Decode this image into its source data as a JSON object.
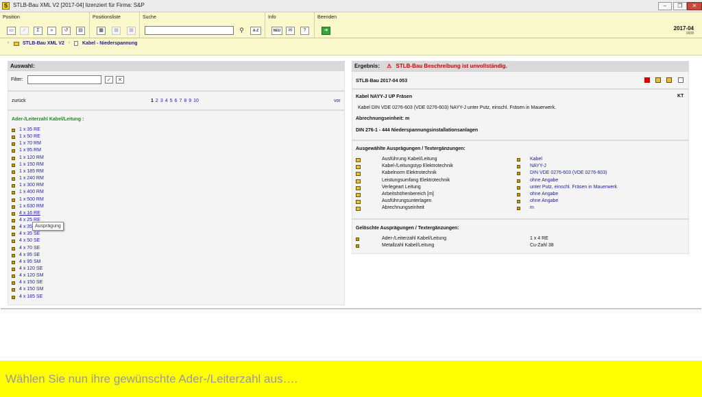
{
  "window": {
    "title": "STLB-Bau XML V2 [2017-04] lizenziert für Firma: S&P",
    "app_icon": "S"
  },
  "toolbar": {
    "groups": [
      "Position",
      "Positionsliste",
      "Suche",
      "Info",
      "Beenden"
    ],
    "search_btn_az": "A-Z",
    "info_new": "NEU",
    "version": "2017-04",
    "version_sub": "0008"
  },
  "breadcrumb": {
    "root": "STLB-Bau XML V2",
    "current": "Kabel - Niederspannung"
  },
  "left": {
    "header": "Auswahl:",
    "filter_label": "Filter:",
    "filter_value": "",
    "back": "zurück",
    "forward": "vor",
    "pages": [
      "1",
      "2",
      "3",
      "4",
      "5",
      "6",
      "7",
      "8",
      "9",
      "10"
    ],
    "current_page": "1",
    "list_title": "Ader-/Leiterzahl Kabel/Leitung :",
    "items": [
      "1 x 35 RE",
      "1 x 50 RE",
      "1 x 70 RM",
      "1 x 95 RM",
      "1 x 120 RM",
      "1 x 150 RM",
      "1 x 185 RM",
      "1 x 240 RM",
      "1 x 300 RM",
      "1 x 400 RM",
      "1 x 500 RM",
      "1 x 630 RM",
      "4 x 16 RE",
      "4 x 25 RE",
      "4 x 35 SE",
      "4 x 35 SE",
      "4 x 50 SE",
      "4 x 70 SE",
      "4 x 95 SE",
      "4 x 95 SM",
      "4 x 120 SE",
      "4 x 120 SM",
      "4 x 150 SE",
      "4 x 150 SM",
      "4 x 185 SE"
    ],
    "tooltip": "Ausprägung"
  },
  "right": {
    "header_label": "Ergebnis:",
    "header_warning": "STLB-Bau Beschreibung ist unvollständig.",
    "edition": "STLB-Bau 2017-04 053",
    "title": "Kabel NAYY-J UP Fräsen",
    "code": "KT",
    "description": "Kabel DIN VDE 0276-603 (VDE 0276-603) NAYY-J unter Putz, einschl. Fräsen in Mauerwerk.",
    "unit_line": "Abrechnungseinheit: m",
    "din_line": "DIN 276-1 - 444 Niederspannungsinstallationsanlagen",
    "selected_title": "Ausgewählte Ausprägungen / Textergänzungen:",
    "selected": [
      {
        "label": "Ausführung Kabel/Leitung",
        "value": "Kabel"
      },
      {
        "label": "Kabel-/Leitungstyp Elektrotechnik",
        "value": "NAYY-J"
      },
      {
        "label": "Kabelnorm Elektrotechnik",
        "value": "DIN VDE 0276-603 (VDE 0276-603)"
      },
      {
        "label": "Leistungsumfang Elektrotechnik",
        "value": "ohne Angabe"
      },
      {
        "label": "Verlegeart Leitung",
        "value": "unter Putz, einschl. Fräsen in Mauerwerk"
      },
      {
        "label": "Arbeitshöhenbereich [m]",
        "value": "ohne Angabe"
      },
      {
        "label": "Ausführungsunterlagen",
        "value": "ohne Angabe"
      },
      {
        "label": "Abrechnungseinheit",
        "value": "m"
      }
    ],
    "deleted_title": "Gelöschte Ausprägungen / Textergänzungen:",
    "deleted": [
      {
        "label": "Ader-/Leiterzahl Kabel/Leitung",
        "value": "1 x 4 RE"
      },
      {
        "label": "Metallzahl Kabel/Leitung",
        "value": "Cu-Zahl 38"
      }
    ]
  },
  "banner": {
    "text": "Wählen Sie nun ihre gewünschte Ader-/Leiterzahl  aus…."
  },
  "colors": {
    "toolbar_bg": "#fbf8cc",
    "banner_bg": "#ffff00",
    "link": "#1a1ab0",
    "warning": "#d40000",
    "ok_green": "#1e8a1e"
  }
}
